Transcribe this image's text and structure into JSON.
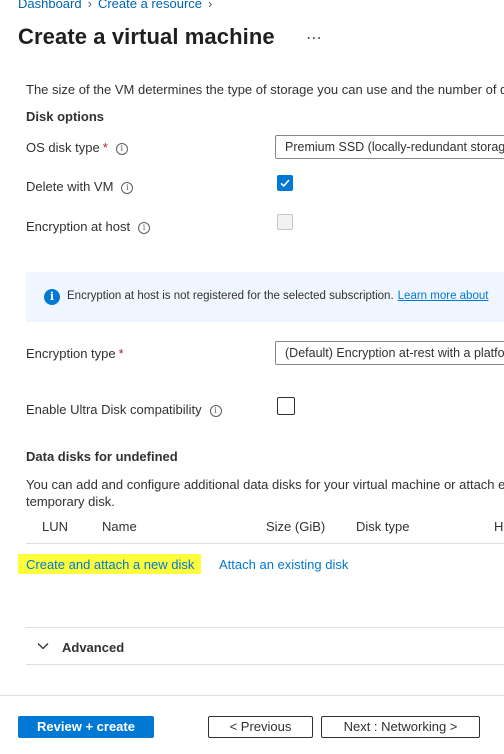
{
  "breadcrumb": {
    "items": [
      "Dashboard",
      "Create a resource"
    ]
  },
  "page": {
    "title": "Create a virtual machine",
    "more_label": "⋯",
    "size_description": "The size of the VM determines the type of storage you can use and the number of d"
  },
  "disk_options": {
    "heading": "Disk options",
    "os_disk_type_label": "OS disk type",
    "os_disk_type_value": "Premium SSD (locally-redundant storage)",
    "delete_with_vm_label": "Delete with VM",
    "delete_with_vm_checked": true,
    "encryption_host_label": "Encryption at host",
    "encryption_host_checked": false,
    "info_message": "Encryption at host is not registered for the selected subscription.",
    "info_link": "Learn more about",
    "encryption_type_label": "Encryption type",
    "encryption_type_value": "(Default) Encryption at-rest with a platform-managed key",
    "ultra_disk_label": "Enable Ultra Disk compatibility",
    "ultra_disk_checked": false,
    "required_marker": "*"
  },
  "data_disks": {
    "heading": "Data disks for undefined",
    "description_line1": "You can add and configure additional data disks for your virtual machine or attach e",
    "description_line2": "temporary disk.",
    "columns": [
      "LUN",
      "Name",
      "Size (GiB)",
      "Disk type",
      "H"
    ],
    "create_link": "Create and attach a new disk",
    "attach_link": "Attach an existing disk"
  },
  "advanced": {
    "label": "Advanced",
    "expanded": false
  },
  "footer": {
    "review_create": "Review + create",
    "previous": "< Previous",
    "next": "Next : Networking >"
  },
  "colors": {
    "accent": "#0078d4",
    "link": "#0078d4",
    "required": "#a4262c",
    "highlight": "#fdfd3c",
    "info_background": "#f0f6ff"
  },
  "icons": {
    "info": "info-circle-icon",
    "info_filled": "info-filled-icon",
    "checkmark": "checkmark-icon",
    "chevron": "chevron-down-icon",
    "breadcrumb_separator": "chevron-right-icon"
  }
}
